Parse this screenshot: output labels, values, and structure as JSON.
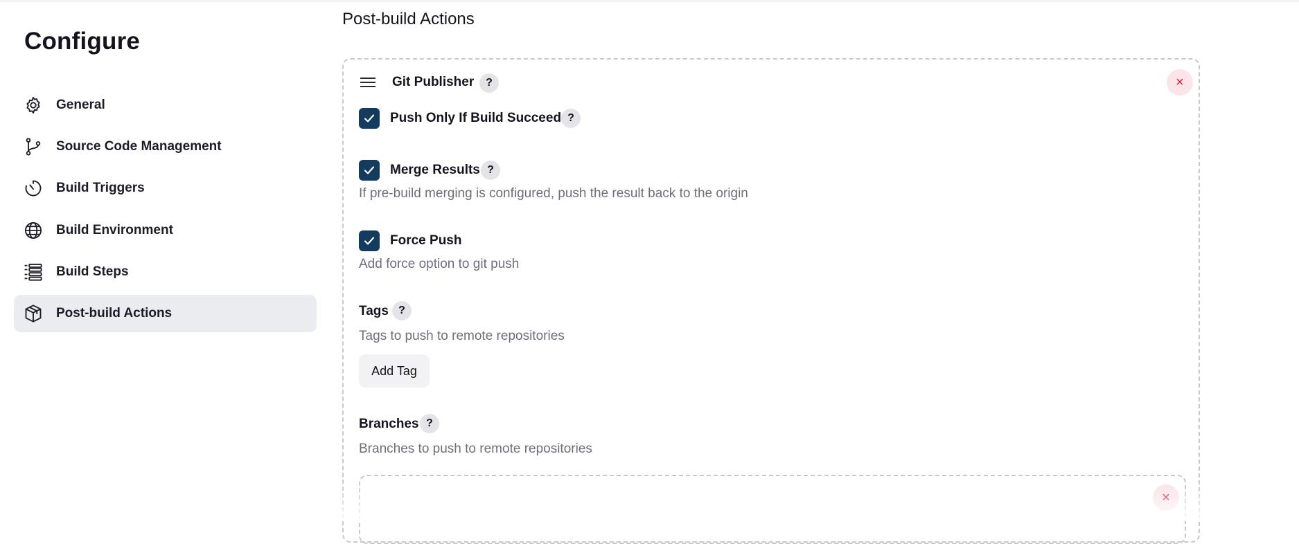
{
  "sidebar": {
    "title": "Configure",
    "items": [
      {
        "label": "General",
        "icon": "gear-icon"
      },
      {
        "label": "Source Code Management",
        "icon": "git-branch-icon"
      },
      {
        "label": "Build Triggers",
        "icon": "timer-icon"
      },
      {
        "label": "Build Environment",
        "icon": "globe-icon"
      },
      {
        "label": "Build Steps",
        "icon": "list-icon"
      },
      {
        "label": "Post-build Actions",
        "icon": "package-icon",
        "active": true
      }
    ]
  },
  "main": {
    "title": "Post-build Actions",
    "publisher": {
      "title": "Git Publisher",
      "help": "?",
      "close": "×",
      "options": [
        {
          "label": "Push Only If Build Succeeds",
          "checked": true,
          "help": "?",
          "description": ""
        },
        {
          "label": "Merge Results",
          "checked": true,
          "help": "?",
          "description": "If pre-build merging is configured, push the result back to the origin"
        },
        {
          "label": "Force Push",
          "checked": true,
          "description": "Add force option to git push"
        }
      ],
      "tags": {
        "label": "Tags",
        "help": "?",
        "description": "Tags to push to remote repositories",
        "add_button": "Add Tag"
      },
      "branches": {
        "label": "Branches",
        "help": "?",
        "description": "Branches to push to remote repositories",
        "close": "×"
      }
    }
  },
  "colors": {
    "checkbox": "#123b5e",
    "close": "#d0223c",
    "close_bg": "#fbe5e8",
    "active_bg": "#ebecf0"
  }
}
